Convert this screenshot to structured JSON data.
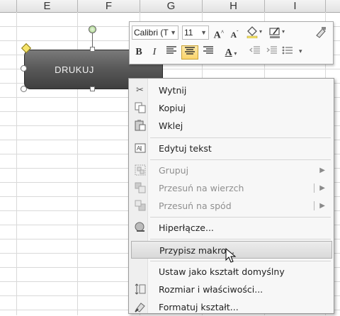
{
  "columns": [
    "E",
    "F",
    "G",
    "H",
    "I"
  ],
  "shape": {
    "label": "DRUKUJ",
    "fill_top": "#7a7a7a",
    "fill_bottom": "#3f3f3f"
  },
  "mini_toolbar": {
    "font_name": "Calibri (T",
    "font_size": "11",
    "grow_font": "A",
    "shrink_font": "A",
    "bold": "B",
    "italic": "I",
    "font_color_letter": "A"
  },
  "context_menu": {
    "items": [
      {
        "label": "Wytnij",
        "icon": "scissors-icon",
        "enabled": true
      },
      {
        "label": "Kopiuj",
        "icon": "copy-icon",
        "enabled": true
      },
      {
        "label": "Wklej",
        "icon": "paste-icon",
        "enabled": true
      },
      {
        "label": "Edytuj tekst",
        "icon": "edit-text-icon",
        "enabled": true
      },
      {
        "label": "Grupuj",
        "icon": "group-icon",
        "enabled": false
      },
      {
        "label": "Przesuń na wierzch",
        "icon": "bring-front-icon",
        "enabled": false
      },
      {
        "label": "Przesuń na spód",
        "icon": "send-back-icon",
        "enabled": false
      },
      {
        "label": "Hiperłącze...",
        "icon": "hyperlink-icon",
        "enabled": true
      },
      {
        "label": "Przypisz makro...",
        "icon": "",
        "enabled": true,
        "highlighted": true
      },
      {
        "label": "Ustaw jako kształt domyślny",
        "icon": "",
        "enabled": true
      },
      {
        "label": "Rozmiar i właściwości...",
        "icon": "size-properties-icon",
        "enabled": true
      },
      {
        "label": "Formatuj kształt...",
        "icon": "format-shape-icon",
        "enabled": true
      }
    ],
    "highlight_color": "#d9d9d9"
  }
}
